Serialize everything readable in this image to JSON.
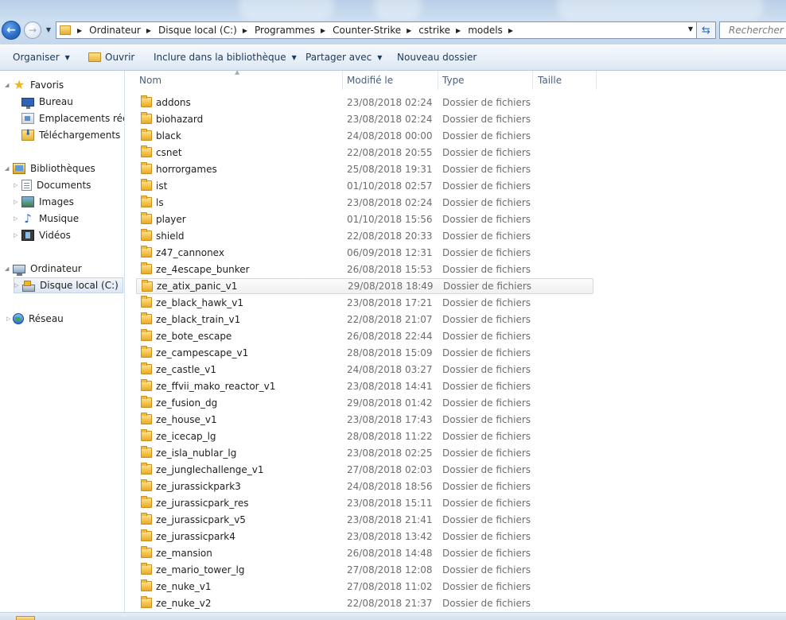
{
  "window": {
    "breadcrumbs": [
      "Ordinateur",
      "Disque local (C:)",
      "Programmes",
      "Counter-Strike",
      "cstrike",
      "models"
    ],
    "search_placeholder": "Rechercher dans : models"
  },
  "toolbar": {
    "organize": "Organiser",
    "open": "Ouvrir",
    "include": "Inclure dans la bibliothèque",
    "share": "Partager avec",
    "new_folder": "Nouveau dossier"
  },
  "sidebar": {
    "favorites": "Favoris",
    "desktop": "Bureau",
    "recent": "Emplacements récents",
    "downloads": "Téléchargements",
    "libraries": "Bibliothèques",
    "documents": "Documents",
    "images": "Images",
    "music": "Musique",
    "videos": "Vidéos",
    "computer": "Ordinateur",
    "local_disk": "Disque local (C:)",
    "network": "Réseau"
  },
  "columns": {
    "name": "Nom",
    "modified": "Modifié le",
    "type": "Type",
    "size": "Taille"
  },
  "files": [
    {
      "name": "addons",
      "date": "23/08/2018 02:24",
      "type": "Dossier de fichiers"
    },
    {
      "name": "biohazard",
      "date": "23/08/2018 02:24",
      "type": "Dossier de fichiers"
    },
    {
      "name": "black",
      "date": "24/08/2018 00:00",
      "type": "Dossier de fichiers"
    },
    {
      "name": "csnet",
      "date": "22/08/2018 20:55",
      "type": "Dossier de fichiers"
    },
    {
      "name": "horrorgames",
      "date": "25/08/2018 19:31",
      "type": "Dossier de fichiers"
    },
    {
      "name": "ist",
      "date": "01/10/2018 02:57",
      "type": "Dossier de fichiers"
    },
    {
      "name": "ls",
      "date": "23/08/2018 02:24",
      "type": "Dossier de fichiers"
    },
    {
      "name": "player",
      "date": "01/10/2018 15:56",
      "type": "Dossier de fichiers"
    },
    {
      "name": "shield",
      "date": "22/08/2018 20:33",
      "type": "Dossier de fichiers"
    },
    {
      "name": "z47_cannonex",
      "date": "06/09/2018 12:31",
      "type": "Dossier de fichiers"
    },
    {
      "name": "ze_4escape_bunker",
      "date": "26/08/2018 15:53",
      "type": "Dossier de fichiers"
    },
    {
      "name": "ze_atix_panic_v1",
      "date": "29/08/2018 18:49",
      "type": "Dossier de fichiers"
    },
    {
      "name": "ze_black_hawk_v1",
      "date": "23/08/2018 17:21",
      "type": "Dossier de fichiers"
    },
    {
      "name": "ze_black_train_v1",
      "date": "22/08/2018 21:07",
      "type": "Dossier de fichiers"
    },
    {
      "name": "ze_bote_escape",
      "date": "26/08/2018 22:44",
      "type": "Dossier de fichiers"
    },
    {
      "name": "ze_campescape_v1",
      "date": "28/08/2018 15:09",
      "type": "Dossier de fichiers"
    },
    {
      "name": "ze_castle_v1",
      "date": "24/08/2018 03:27",
      "type": "Dossier de fichiers"
    },
    {
      "name": "ze_ffvii_mako_reactor_v1",
      "date": "23/08/2018 14:41",
      "type": "Dossier de fichiers"
    },
    {
      "name": "ze_fusion_dg",
      "date": "29/08/2018 01:42",
      "type": "Dossier de fichiers"
    },
    {
      "name": "ze_house_v1",
      "date": "23/08/2018 17:43",
      "type": "Dossier de fichiers"
    },
    {
      "name": "ze_icecap_lg",
      "date": "28/08/2018 11:22",
      "type": "Dossier de fichiers"
    },
    {
      "name": "ze_isla_nublar_lg",
      "date": "23/08/2018 02:25",
      "type": "Dossier de fichiers"
    },
    {
      "name": "ze_junglechallenge_v1",
      "date": "27/08/2018 02:03",
      "type": "Dossier de fichiers"
    },
    {
      "name": "ze_jurassickpark3",
      "date": "24/08/2018 18:56",
      "type": "Dossier de fichiers"
    },
    {
      "name": "ze_jurassicpark_res",
      "date": "23/08/2018 15:11",
      "type": "Dossier de fichiers"
    },
    {
      "name": "ze_jurassicpark_v5",
      "date": "23/08/2018 21:41",
      "type": "Dossier de fichiers"
    },
    {
      "name": "ze_jurassicpark4",
      "date": "23/08/2018 13:42",
      "type": "Dossier de fichiers"
    },
    {
      "name": "ze_mansion",
      "date": "26/08/2018 14:48",
      "type": "Dossier de fichiers"
    },
    {
      "name": "ze_mario_tower_lg",
      "date": "27/08/2018 12:08",
      "type": "Dossier de fichiers"
    },
    {
      "name": "ze_nuke_v1",
      "date": "27/08/2018 11:02",
      "type": "Dossier de fichiers"
    },
    {
      "name": "ze_nuke_v2",
      "date": "22/08/2018 21:37",
      "type": "Dossier de fichiers"
    }
  ],
  "hovered_row": "ze_atix_panic_v1"
}
